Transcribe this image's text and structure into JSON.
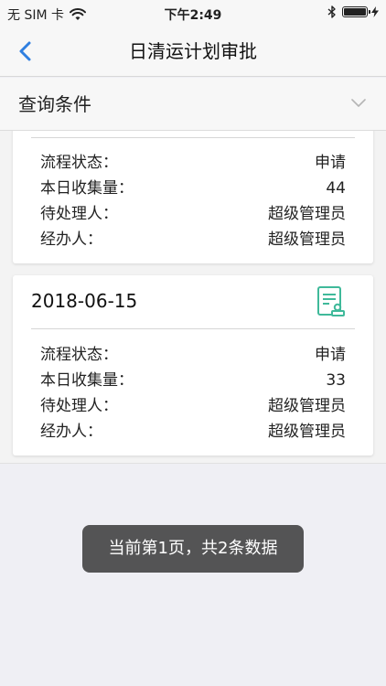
{
  "status_bar": {
    "carrier": "无 SIM 卡",
    "time": "下午2:49",
    "wifi_icon": "wifi-icon",
    "bluetooth_icon": "bluetooth-icon",
    "battery_icon": "battery-icon",
    "battery_level_percent": 100
  },
  "nav": {
    "title": "日清运计划审批",
    "back_icon": "chevron-left-icon"
  },
  "query": {
    "label": "查询条件",
    "expand_icon": "chevron-down-icon"
  },
  "records": [
    {
      "fields": [
        {
          "label": "流程状态：",
          "value": "申请"
        },
        {
          "label": "本日收集量：",
          "value": "44"
        },
        {
          "label": "待处理人：",
          "value": "超级管理员"
        },
        {
          "label": "经办人：",
          "value": "超级管理员"
        }
      ]
    },
    {
      "date": "2018-06-15",
      "icon": "approval-document-icon",
      "fields": [
        {
          "label": "流程状态：",
          "value": "申请"
        },
        {
          "label": "本日收集量：",
          "value": "33"
        },
        {
          "label": "待处理人：",
          "value": "超级管理员"
        },
        {
          "label": "经办人：",
          "value": "超级管理员"
        }
      ]
    }
  ],
  "toast": {
    "text": "当前第1页，共2条数据"
  },
  "colors": {
    "accent": "#2f7fe0",
    "icon_green": "#3fb99a",
    "toast_bg": "#464646"
  }
}
